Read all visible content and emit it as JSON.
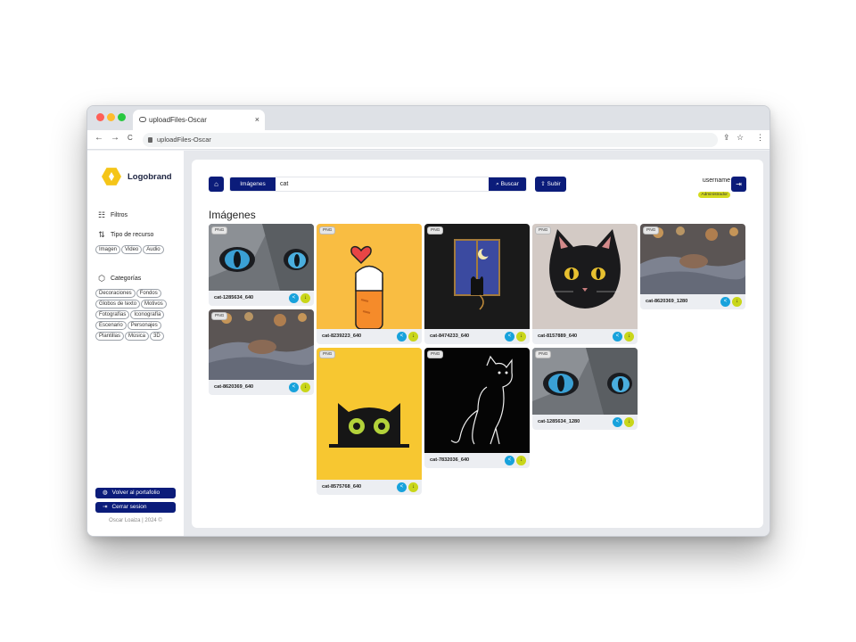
{
  "browser": {
    "tab_title": "uploadFiles-Oscar",
    "url": "uploadFiles-Oscar",
    "close": "×",
    "back": "←",
    "forward": "→",
    "reload": "C",
    "share_glyph": "⇪",
    "star_glyph": "☆",
    "menu_glyph": "⋮"
  },
  "sidebar": {
    "brand": "Logobrand",
    "filters_label": "Filtros",
    "resource_type_label": "Tipo de recurso",
    "resource_types": [
      "Imagen",
      "Video",
      "Audio"
    ],
    "categories_label": "Categorías",
    "categories": [
      "Decoraciones",
      "Fondos",
      "Globos de texto",
      "Motivos",
      "Fotografías",
      "Iconografía",
      "Escenario",
      "Personajes",
      "Plantillas",
      "Música",
      "3D"
    ],
    "portfolio_button": "Volver al portafolio",
    "logout_button": "Cerrar sesion",
    "footer": "Oscar Loaiza | 2024 ©"
  },
  "header": {
    "type_select": "Imágenes",
    "search_value": "cat",
    "search_button": "Buscar",
    "upload_button": "Subir",
    "username": "username",
    "role": "Administrador"
  },
  "content": {
    "title": "Imágenes",
    "cards": [
      {
        "badge": "PNG",
        "name": "cat-1285634_640"
      },
      {
        "badge": "PNG",
        "name": "cat-8620369_640"
      },
      {
        "badge": "PNG",
        "name": "cat-8239223_640"
      },
      {
        "badge": "PNG",
        "name": "cat-8575768_640"
      },
      {
        "badge": "PNG",
        "name": "cat-8474233_640"
      },
      {
        "badge": "PNG",
        "name": "cat-7832036_640"
      },
      {
        "badge": "PNG",
        "name": "cat-8157889_640"
      },
      {
        "badge": "PNG",
        "name": "cat-1285634_1280"
      },
      {
        "badge": "PNG",
        "name": "cat-8620369_1280"
      }
    ]
  },
  "colors": {
    "accent": "#0b1c7a",
    "share": "#18a2dc",
    "download": "#c9d61a",
    "role_badge": "#d4db1e"
  }
}
